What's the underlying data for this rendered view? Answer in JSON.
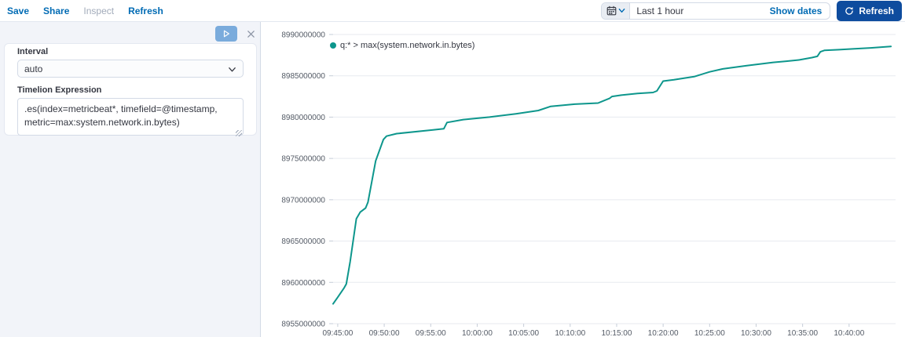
{
  "topbar": {
    "links": [
      {
        "label": "Save",
        "disabled": false
      },
      {
        "label": "Share",
        "disabled": false
      },
      {
        "label": "Inspect",
        "disabled": true
      },
      {
        "label": "Refresh",
        "disabled": false
      }
    ],
    "timepicker": {
      "value": "Last 1 hour",
      "show_dates_label": "Show dates",
      "refresh_button_label": "Refresh"
    }
  },
  "sidebar": {
    "interval_label": "Interval",
    "interval_value": "auto",
    "expression_label": "Timelion Expression",
    "expression_value": ".es(index=metricbeat*, timefield=@timestamp, metric=max:system.network.in.bytes)"
  },
  "colors": {
    "link_blue": "#006BB4",
    "refresh_button": "#0e4c9e",
    "series_teal": "#0d968c",
    "gridline": "#e7eaef",
    "tick": "#c6cdd8",
    "axis_text": "#545b66"
  },
  "chart_data": {
    "type": "line",
    "title": "",
    "legend": "q:* > max(system.network.in.bytes)",
    "color": "#0d968c",
    "legend_position": "top-left",
    "grid": "horizontal",
    "xlabel": "",
    "ylabel": "",
    "x_domain": [
      "09:44:30",
      "10:45:00"
    ],
    "ylim": [
      8955000000,
      8990000000
    ],
    "y_ticks": [
      8955000000,
      8960000000,
      8965000000,
      8970000000,
      8975000000,
      8980000000,
      8985000000,
      8990000000
    ],
    "x_ticks": [
      "09:45:00",
      "09:50:00",
      "09:55:00",
      "10:00:00",
      "10:05:00",
      "10:10:00",
      "10:15:00",
      "10:20:00",
      "10:25:00",
      "10:30:00",
      "10:35:00",
      "10:40:00"
    ],
    "points": [
      [
        "09:44:30",
        8957400000
      ],
      [
        "09:45:00",
        8958200000
      ],
      [
        "09:45:40",
        8959300000
      ],
      [
        "09:45:55",
        8959800000
      ],
      [
        "09:46:20",
        8962500000
      ],
      [
        "09:47:00",
        8967700000
      ],
      [
        "09:47:25",
        8968500000
      ],
      [
        "09:48:00",
        8969000000
      ],
      [
        "09:48:15",
        8969700000
      ],
      [
        "09:49:05",
        8974700000
      ],
      [
        "09:49:55",
        8977300000
      ],
      [
        "09:50:15",
        8977700000
      ],
      [
        "09:51:20",
        8978000000
      ],
      [
        "09:55:15",
        8978450000
      ],
      [
        "09:56:25",
        8978600000
      ],
      [
        "09:56:45",
        8979350000
      ],
      [
        "09:58:30",
        8979700000
      ],
      [
        "10:01:20",
        8980000000
      ],
      [
        "10:04:10",
        8980400000
      ],
      [
        "10:06:35",
        8980800000
      ],
      [
        "10:07:55",
        8981300000
      ],
      [
        "10:10:30",
        8981570000
      ],
      [
        "10:13:00",
        8981700000
      ],
      [
        "10:14:15",
        8982280000
      ],
      [
        "10:14:30",
        8982500000
      ],
      [
        "10:15:30",
        8982660000
      ],
      [
        "10:17:15",
        8982860000
      ],
      [
        "10:18:55",
        8982980000
      ],
      [
        "10:19:20",
        8983170000
      ],
      [
        "10:20:00",
        8984360000
      ],
      [
        "10:21:10",
        8984520000
      ],
      [
        "10:23:20",
        8984900000
      ],
      [
        "10:25:00",
        8985480000
      ],
      [
        "10:26:25",
        8985840000
      ],
      [
        "10:29:00",
        8986230000
      ],
      [
        "10:31:50",
        8986620000
      ],
      [
        "10:33:15",
        8986770000
      ],
      [
        "10:34:40",
        8986930000
      ],
      [
        "10:36:00",
        8987200000
      ],
      [
        "10:36:35",
        8987350000
      ],
      [
        "10:36:55",
        8987900000
      ],
      [
        "10:37:20",
        8988070000
      ],
      [
        "10:38:55",
        8988160000
      ],
      [
        "10:40:35",
        8988260000
      ],
      [
        "10:42:20",
        8988380000
      ],
      [
        "10:44:30",
        8988550000
      ]
    ]
  }
}
